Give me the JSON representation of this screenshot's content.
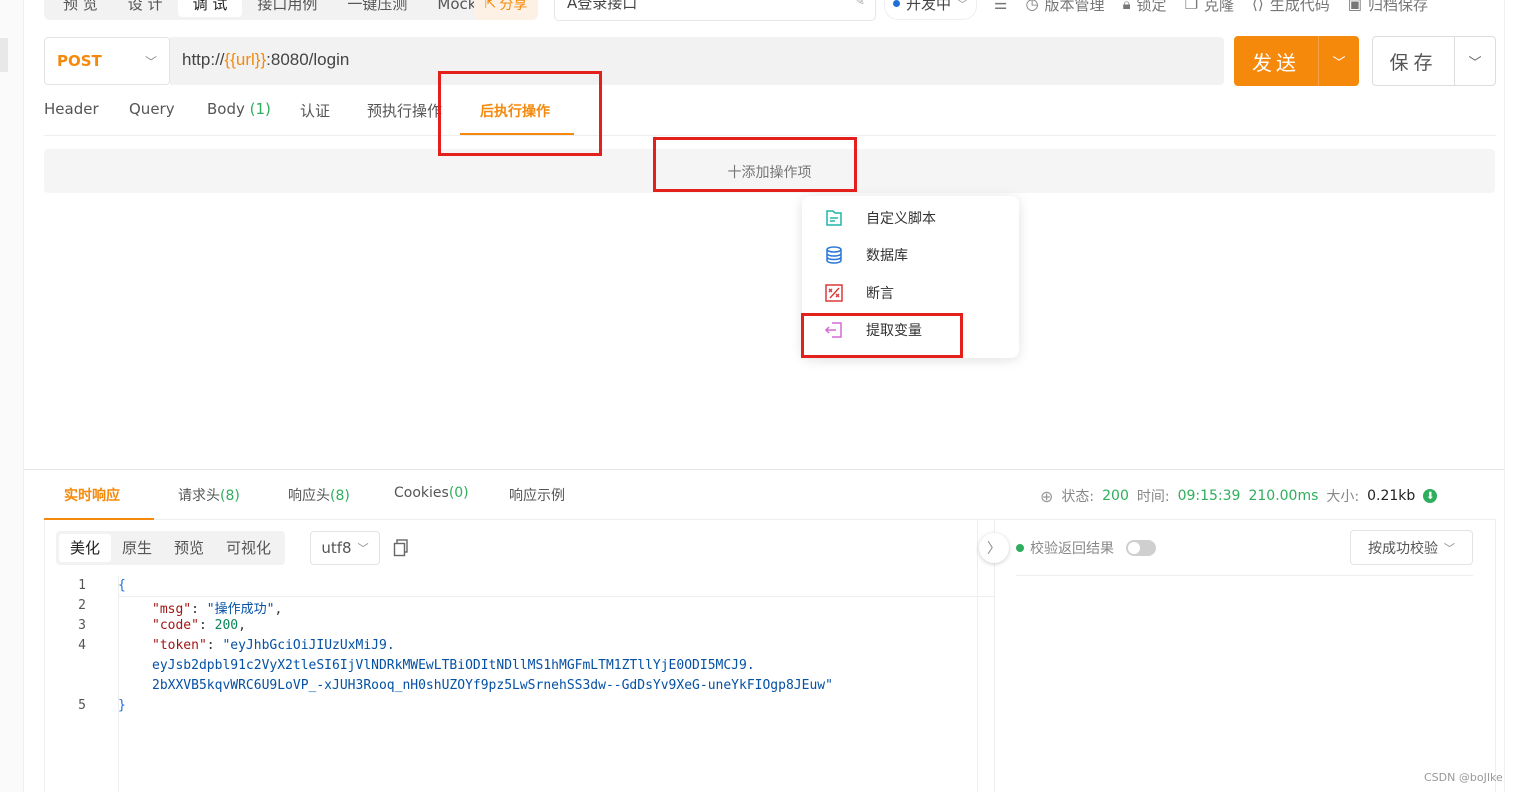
{
  "toolbar": {
    "mode_tabs": [
      "预 览",
      "设 计",
      "调 试",
      "接口用例",
      "一键压测",
      "Mock"
    ],
    "share_label": "分享",
    "api_name": "A登录接口",
    "env_label": "开发中",
    "actions": {
      "version": "版本管理",
      "lock": "锁定",
      "clone": "克隆",
      "gen_code": "生成代码",
      "archive": "归档保存"
    }
  },
  "request": {
    "method": "POST",
    "url_prefix": "http://",
    "url_var": "{{url}}",
    "url_suffix": ":8080/login",
    "send_label": "发送",
    "save_label": "保存"
  },
  "req_tabs": {
    "header": "Header",
    "query": "Query",
    "body": "Body",
    "body_count": "(1)",
    "auth": "认证",
    "pre": "预执行操作",
    "post": "后执行操作"
  },
  "add_op_label": "十添加操作项",
  "op_menu": {
    "custom_script": "自定义脚本",
    "database": "数据库",
    "assertion": "断言",
    "extract_var": "提取变量"
  },
  "response": {
    "tabs": {
      "live": "实时响应",
      "req_headers": "请求头",
      "req_headers_count": "(8)",
      "resp_headers": "响应头",
      "resp_headers_count": "(8)",
      "cookies": "Cookies",
      "cookies_count": "(0)",
      "example": "响应示例"
    },
    "status_label": "状态:",
    "status_value": "200",
    "time_label": "时间:",
    "time_value": "09:15:39",
    "duration": "210.00ms",
    "size_label": "大小:",
    "size_value": "0.21kb",
    "view_tabs": [
      "美化",
      "原生",
      "预览",
      "可视化"
    ],
    "encoding": "utf8",
    "code": {
      "line_numbers": [
        "1",
        "2",
        "3",
        "4",
        "5"
      ],
      "open_brace": "{",
      "msg_key": "\"msg\"",
      "msg_value": "\"操作成功\"",
      "code_key": "\"code\"",
      "code_value": "200",
      "token_key": "\"token\"",
      "token_part1": "\"eyJhbGciOiJIUzUxMiJ9.",
      "token_part2": "eyJsb2dpbl91c2VyX2tleSI6IjVlNDRkMWEwLTBiODItNDllMS1hMGFmLTM1ZTllYjE0ODI5MCJ9.",
      "token_part3": "2bXXVB5kqvWRC6U9LoVP_-xJUH3Rooq_nH0shUZOYf9pz5LwSrnehSS3dw--GdDsYv9XeG-uneYkFIOgp8JEuw\"",
      "close_brace": "}"
    },
    "validate_label": "校验返回结果",
    "validate_select": "按成功校验"
  },
  "watermark": "CSDN @boJIke",
  "colors": {
    "accent": "#f5890b",
    "success": "#2fae5d",
    "highlight": "#e3201b"
  }
}
